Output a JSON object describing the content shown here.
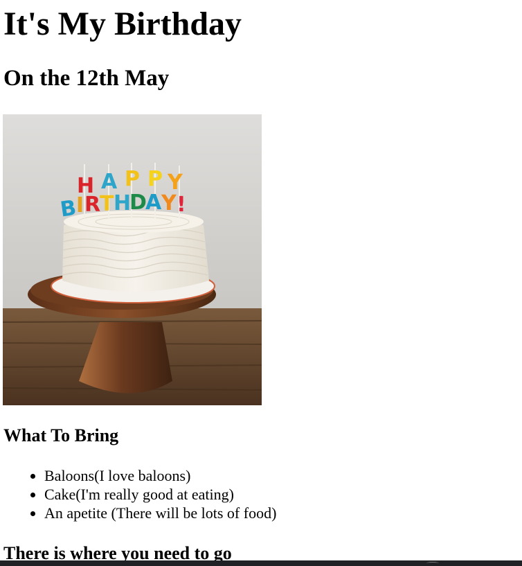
{
  "page": {
    "title": "It's My Birthday",
    "date": "On the 12th May"
  },
  "cake_image": {
    "icon": "birthday-cake-photo",
    "candle_letters_top": [
      "H",
      "A",
      "P",
      "P",
      "Y"
    ],
    "candle_letters_bottom": [
      "B",
      "I",
      "R",
      "T",
      "H",
      "D",
      "A",
      "Y",
      "!"
    ],
    "colors": {
      "wall": "#d9d8d6",
      "wood_table": "#6b4a30",
      "stand": "#7a4527",
      "frosting": "#f2eee6",
      "plate_rim": "#d1603d"
    }
  },
  "bring": {
    "heading": "What To Bring",
    "items": [
      "Baloons(I love baloons)",
      "Cake(I'm really good at eating)",
      "An apetite (There will be lots of food)"
    ]
  },
  "location": {
    "heading": "There is where you need to go"
  }
}
